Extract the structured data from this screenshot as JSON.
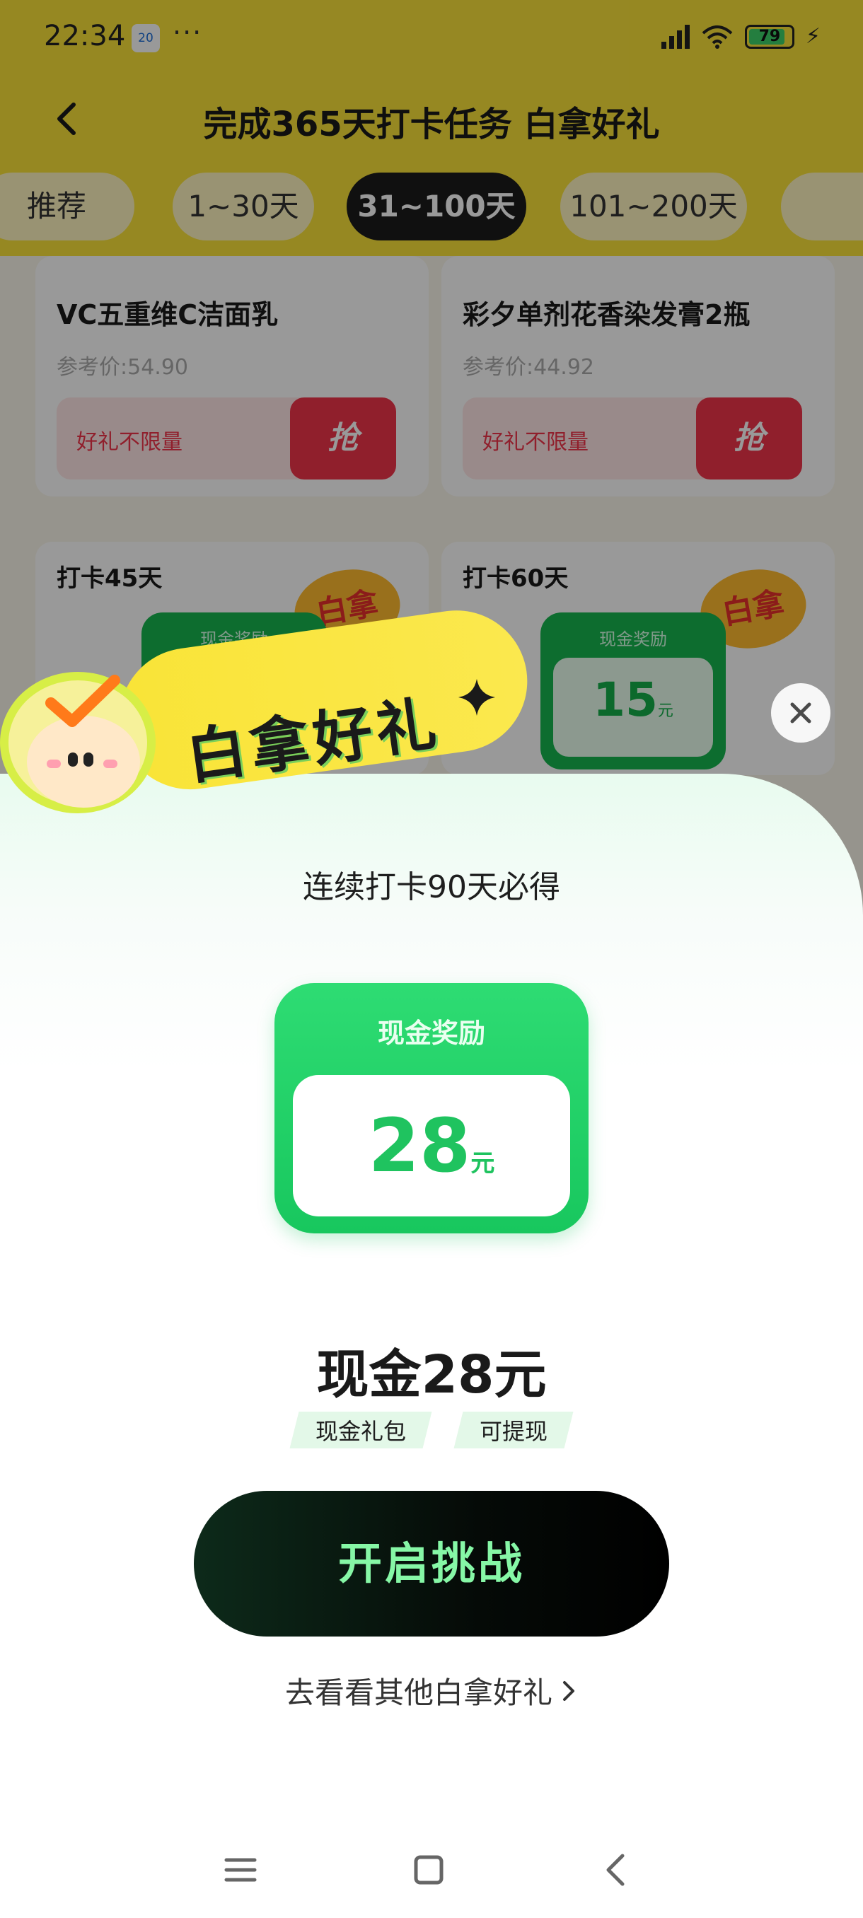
{
  "status": {
    "time": "22:34",
    "notification": "20",
    "dots": "···",
    "battery": "79"
  },
  "nav": {
    "title": "完成365天打卡任务 白拿好礼"
  },
  "tabs": [
    {
      "label": "推荐",
      "active": false
    },
    {
      "label": "1~30天",
      "active": false
    },
    {
      "label": "31~100天",
      "active": true
    },
    {
      "label": "101~200天",
      "active": false
    }
  ],
  "products": [
    {
      "name": "VC五重维C洁面乳",
      "price": "参考价:54.90",
      "tag": "好礼不限量",
      "badge": "抢"
    },
    {
      "name": "彩夕单剂花香染发膏2瓶",
      "price": "参考价:44.92",
      "tag": "好礼不限量",
      "badge": "抢"
    }
  ],
  "day_cards": [
    {
      "label": "打卡45天",
      "stamp": "白拿",
      "cash_title": "现金奖励",
      "amount": "",
      "unit": ""
    },
    {
      "label": "打卡60天",
      "stamp": "白拿",
      "cash_title": "现金奖励",
      "amount": "15",
      "unit": "元"
    }
  ],
  "modal": {
    "banner": "白拿好礼",
    "subtitle": "连续打卡90天必得",
    "cash_title": "现金奖励",
    "cash_amount": "28",
    "cash_unit": "元",
    "headline": "现金28元",
    "chips": [
      "现金礼包",
      "可提现"
    ],
    "cta": "开启挑战",
    "more_link": "去看看其他白拿好礼"
  },
  "colors": {
    "accent_green": "#1fc35f",
    "banner_yellow": "#fae33a",
    "cta_text": "#86f7a6"
  }
}
